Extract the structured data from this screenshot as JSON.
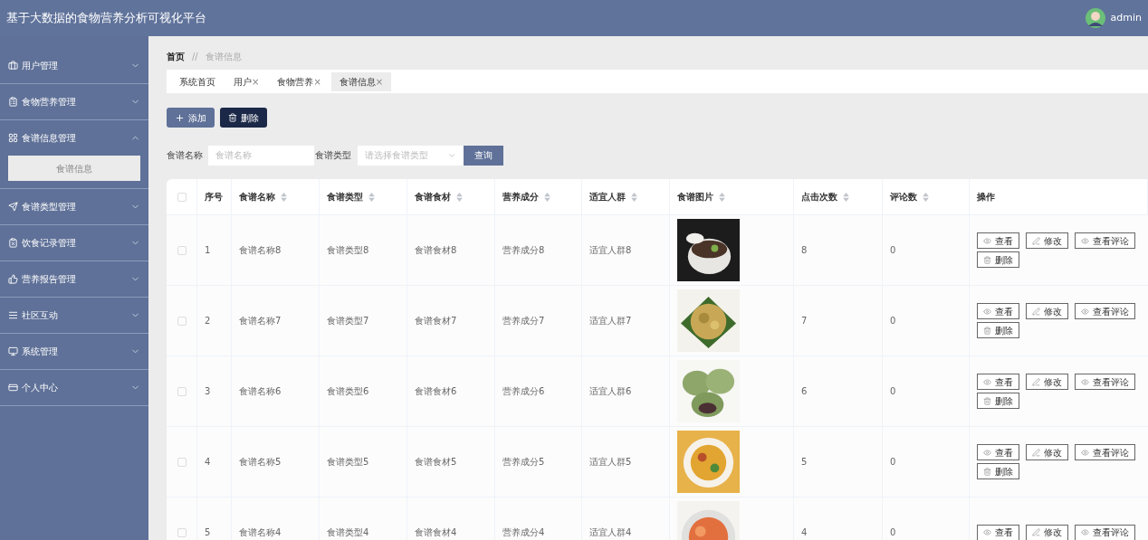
{
  "header": {
    "title": "基于大数据的食物营养分析可视化平台",
    "user": "admin"
  },
  "sidebar": {
    "items": [
      {
        "label": "用户管理",
        "expanded": false
      },
      {
        "label": "食物营养管理",
        "expanded": false
      },
      {
        "label": "食谱信息管理",
        "expanded": true,
        "children": [
          {
            "label": "食谱信息",
            "selected": true
          }
        ]
      },
      {
        "label": "食谱类型管理",
        "expanded": false
      },
      {
        "label": "饮食记录管理",
        "expanded": false
      },
      {
        "label": "营养报告管理",
        "expanded": false
      },
      {
        "label": "社区互动",
        "expanded": false
      },
      {
        "label": "系统管理",
        "expanded": false
      },
      {
        "label": "个人中心",
        "expanded": false
      }
    ]
  },
  "breadcrumb": {
    "home": "首页",
    "separator": "//",
    "current": "食谱信息"
  },
  "tabs": [
    {
      "label": "系统首页",
      "closable": false,
      "selected": false
    },
    {
      "label": "用户",
      "closable": true,
      "selected": false
    },
    {
      "label": "食物营养",
      "closable": true,
      "selected": false
    },
    {
      "label": "食谱信息",
      "closable": true,
      "selected": true
    }
  ],
  "close_mark": "×",
  "toolbar": {
    "add": "添加",
    "delete": "删除"
  },
  "search": {
    "name_label": "食谱名称",
    "name_placeholder": "食谱名称",
    "type_label": "食谱类型",
    "type_placeholder": "请选择食谱类型",
    "button": "查询"
  },
  "table": {
    "select_all_checked": false,
    "columns": [
      {
        "label": "序号",
        "sortable": false
      },
      {
        "label": "食谱名称",
        "sortable": true
      },
      {
        "label": "食谱类型",
        "sortable": true
      },
      {
        "label": "食谱食材",
        "sortable": true
      },
      {
        "label": "营养成分",
        "sortable": true
      },
      {
        "label": "适宜人群",
        "sortable": true
      },
      {
        "label": "食谱图片",
        "sortable": true
      },
      {
        "label": "点击次数",
        "sortable": true
      },
      {
        "label": "评论数",
        "sortable": true
      },
      {
        "label": "操作",
        "sortable": false
      }
    ],
    "rows": [
      {
        "checked": false,
        "cells": [
          "1",
          "食谱名称8",
          "食谱类型8",
          "食谱食材8",
          "营养成分8",
          "适宜人群8"
        ],
        "image": {
          "kind": "picture"
        },
        "clicks": "8",
        "comments": "0",
        "actions": [
          "查看",
          "修改",
          "查看评论",
          "删除"
        ]
      },
      {
        "checked": false,
        "cells": [
          "2",
          "食谱名称7",
          "食谱类型7",
          "食谱食材7",
          "营养成分7",
          "适宜人群7"
        ],
        "image": {
          "kind": "picture"
        },
        "clicks": "7",
        "comments": "0",
        "actions": [
          "查看",
          "修改",
          "查看评论",
          "删除"
        ]
      },
      {
        "checked": false,
        "cells": [
          "3",
          "食谱名称6",
          "食谱类型6",
          "食谱食材6",
          "营养成分6",
          "适宜人群6"
        ],
        "image": {
          "kind": "picture"
        },
        "clicks": "6",
        "comments": "0",
        "actions": [
          "查看",
          "修改",
          "查看评论",
          "删除"
        ]
      },
      {
        "checked": false,
        "cells": [
          "4",
          "食谱名称5",
          "食谱类型5",
          "食谱食材5",
          "营养成分5",
          "适宜人群5"
        ],
        "image": {
          "kind": "picture"
        },
        "clicks": "5",
        "comments": "0",
        "actions": [
          "查看",
          "修改",
          "查看评论",
          "删除"
        ]
      },
      {
        "checked": false,
        "cells": [
          "5",
          "食谱名称4",
          "食谱类型4",
          "食谱食材4",
          "营养成分4",
          "适宜人群4"
        ],
        "image": {
          "kind": "picture"
        },
        "clicks": "4",
        "comments": "0",
        "actions": [
          "查看",
          "修改",
          "查看评论"
        ]
      }
    ]
  }
}
